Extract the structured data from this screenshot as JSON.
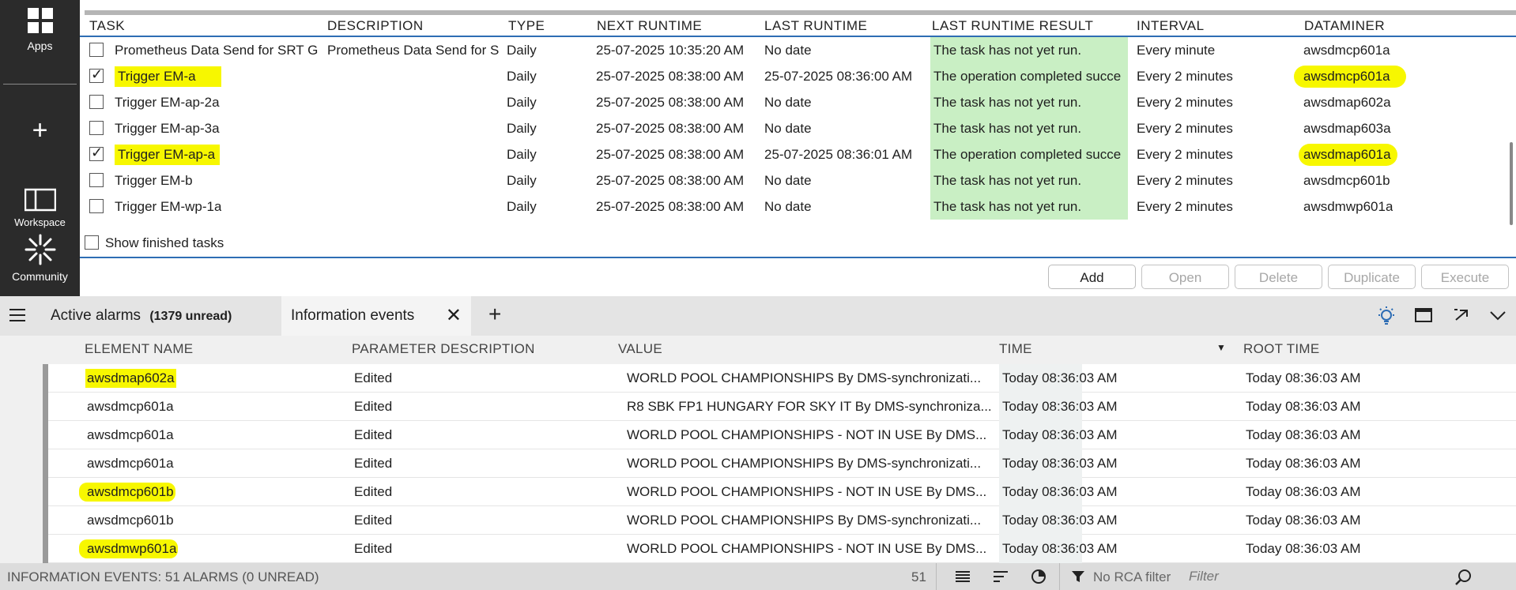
{
  "sidebar": {
    "apps": "Apps",
    "workspace": "Workspace",
    "community": "Community"
  },
  "tasks": {
    "headers": [
      "TASK",
      "DESCRIPTION",
      "TYPE",
      "NEXT RUNTIME",
      "LAST RUNTIME",
      "LAST RUNTIME RESULT",
      "INTERVAL",
      "DATAMINER"
    ],
    "rows": [
      {
        "checked": false,
        "task": "Prometheus Data Send for SRT G",
        "description": "Prometheus Data Send for S",
        "type": "Daily",
        "next": "25-07-2025 10:35:20 AM",
        "last": "No date",
        "result": "The task has not yet run.",
        "interval": "Every minute",
        "dataminer": "awsdmcp601a"
      },
      {
        "checked": true,
        "task": "Trigger EM-a",
        "description": "",
        "type": "Daily",
        "next": "25-07-2025 08:38:00 AM",
        "last": "25-07-2025 08:36:00 AM",
        "result": "The operation completed succe",
        "interval": "Every 2 minutes",
        "dataminer": "awsdmcp601a"
      },
      {
        "checked": false,
        "task": "Trigger EM-ap-2a",
        "description": "",
        "type": "Daily",
        "next": "25-07-2025 08:38:00 AM",
        "last": "No date",
        "result": "The task has not yet run.",
        "interval": "Every 2 minutes",
        "dataminer": "awsdmap602a"
      },
      {
        "checked": false,
        "task": "Trigger EM-ap-3a",
        "description": "",
        "type": "Daily",
        "next": "25-07-2025 08:38:00 AM",
        "last": "No date",
        "result": "The task has not yet run.",
        "interval": "Every 2 minutes",
        "dataminer": "awsdmap603a"
      },
      {
        "checked": true,
        "task": "Trigger EM-ap-a",
        "description": "",
        "type": "Daily",
        "next": "25-07-2025 08:38:00 AM",
        "last": "25-07-2025 08:36:01 AM",
        "result": "The operation completed succe",
        "interval": "Every 2 minutes",
        "dataminer": "awsdmap601a"
      },
      {
        "checked": false,
        "task": "Trigger EM-b",
        "description": "",
        "type": "Daily",
        "next": "25-07-2025 08:38:00 AM",
        "last": "No date",
        "result": "The task has not yet run.",
        "interval": "Every 2 minutes",
        "dataminer": "awsdmcp601b"
      },
      {
        "checked": false,
        "task": "Trigger EM-wp-1a",
        "description": "",
        "type": "Daily",
        "next": "25-07-2025 08:38:00 AM",
        "last": "No date",
        "result": "The task has not yet run.",
        "interval": "Every 2 minutes",
        "dataminer": "awsdmwp601a"
      }
    ],
    "show_finished": "Show finished tasks"
  },
  "actions": {
    "add": "Add",
    "open": "Open",
    "delete": "Delete",
    "duplicate": "Duplicate",
    "execute": "Execute"
  },
  "tabs": {
    "active_alarms": "Active alarms",
    "unread": "(1379 unread)",
    "info_events": "Information events"
  },
  "events": {
    "headers": [
      "ELEMENT NAME",
      "PARAMETER DESCRIPTION",
      "VALUE",
      "TIME",
      "ROOT TIME"
    ],
    "rows": [
      {
        "element": "awsdmap602a",
        "param": "Edited",
        "value": "WORLD POOL CHAMPIONSHIPS By DMS-synchronizati...",
        "time": "Today 08:36:03 AM",
        "root": "Today 08:36:03 AM",
        "highlight": true
      },
      {
        "element": "awsdmcp601a",
        "param": "Edited",
        "value": "R8 SBK FP1 HUNGARY FOR SKY IT By DMS-synchroniza...",
        "time": "Today 08:36:03 AM",
        "root": "Today 08:36:03 AM",
        "highlight": false
      },
      {
        "element": "awsdmcp601a",
        "param": "Edited",
        "value": "WORLD POOL CHAMPIONSHIPS - NOT IN USE By DMS...",
        "time": "Today 08:36:03 AM",
        "root": "Today 08:36:03 AM",
        "highlight": false
      },
      {
        "element": "awsdmcp601a",
        "param": "Edited",
        "value": "WORLD POOL CHAMPIONSHIPS By DMS-synchronizati...",
        "time": "Today 08:36:03 AM",
        "root": "Today 08:36:03 AM",
        "highlight": false
      },
      {
        "element": "awsdmcp601b",
        "param": "Edited",
        "value": "WORLD POOL CHAMPIONSHIPS - NOT IN USE By DMS...",
        "time": "Today 08:36:03 AM",
        "root": "Today 08:36:03 AM",
        "highlight": true
      },
      {
        "element": "awsdmcp601b",
        "param": "Edited",
        "value": "WORLD POOL CHAMPIONSHIPS By DMS-synchronizati...",
        "time": "Today 08:36:03 AM",
        "root": "Today 08:36:03 AM",
        "highlight": false
      },
      {
        "element": "awsdmwp601a",
        "param": "Edited",
        "value": "WORLD POOL CHAMPIONSHIPS - NOT IN USE By DMS...",
        "time": "Today 08:36:03 AM",
        "root": "Today 08:36:03 AM",
        "highlight": true
      }
    ]
  },
  "status": {
    "summary": "INFORMATION EVENTS: 51 ALARMS (0 UNREAD)",
    "count": "51",
    "rca": "No RCA filter",
    "filter_placeholder": "Filter"
  },
  "colors": {
    "highlight": "#f7f700",
    "result_bg": "#c9efc4",
    "sidebar_bg": "#2b2b2b",
    "accent": "#2e6db4"
  },
  "icons": [
    "apps-icon",
    "plus-icon",
    "workspace-icon",
    "community-icon",
    "hamburger-icon",
    "close-icon",
    "lightbulb-icon",
    "window-icon",
    "popout-icon",
    "chevron-down-icon",
    "list-icon",
    "sort-icon",
    "clock-icon",
    "filter-icon",
    "search-icon"
  ]
}
